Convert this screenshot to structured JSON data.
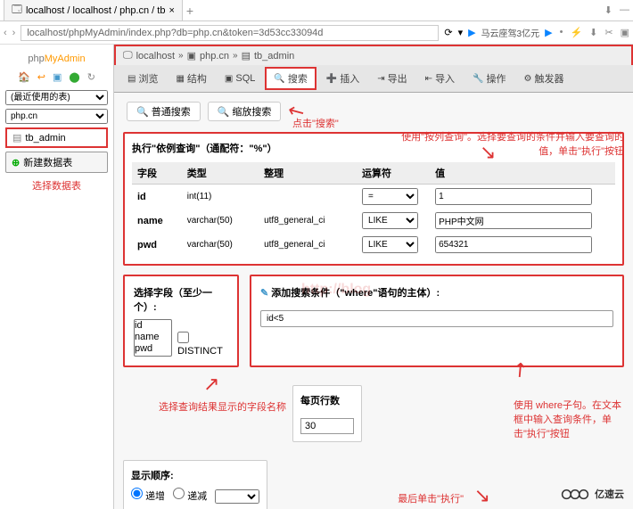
{
  "browser": {
    "tab_title": "localhost / localhost / php.cn / tb",
    "url": "localhost/phpMyAdmin/index.php?db=php.cn&token=3d53cc33094d",
    "fav_text": "马云座驾3亿元"
  },
  "sidebar": {
    "logo_parts": [
      "php",
      "My",
      "Admin"
    ],
    "recent_tables_label": "(最近使用的表)",
    "database": "php.cn",
    "table": "tb_admin",
    "new_table_label": "新建数据表",
    "annotation": "选择数据表"
  },
  "breadcrumb": {
    "host": "localhost",
    "db": "php.cn",
    "table": "tb_admin"
  },
  "tabs": {
    "browse": "浏览",
    "structure": "结构",
    "sql": "SQL",
    "search": "搜索",
    "insert": "插入",
    "export": "导出",
    "import": "导入",
    "operations": "操作",
    "triggers": "触发器"
  },
  "search_anno": "点击\"搜索\"",
  "subtabs": {
    "normal": "普通搜索",
    "zoom": "缩放搜索"
  },
  "query_panel": {
    "title": "执行\"依例查询\"（通配符：\"%\"）",
    "anno": "使用\"按列查询\"。选择要查询的条件并输入要查询的值，单击\"执行\"按钮",
    "headers": {
      "field": "字段",
      "type": "类型",
      "collation": "整理",
      "operator": "运算符",
      "value": "值"
    },
    "rows": [
      {
        "field": "id",
        "type": "int(11)",
        "collation": "",
        "operator": "=",
        "value": "1"
      },
      {
        "field": "name",
        "type": "varchar(50)",
        "collation": "utf8_general_ci",
        "operator": "LIKE",
        "value": "PHP中文网"
      },
      {
        "field": "pwd",
        "type": "varchar(50)",
        "collation": "utf8_general_ci",
        "operator": "LIKE",
        "value": "654321"
      }
    ]
  },
  "select_fields": {
    "title": "选择字段（至少一个）:",
    "options": [
      "id",
      "name",
      "pwd"
    ],
    "distinct_label": "DISTINCT",
    "anno": "选择查询结果显示的字段名称"
  },
  "where": {
    "title": "添加搜索条件（\"where\"语句的主体）:",
    "value": "id<5",
    "anno": "使用 where子句。在文本框中输入查询条件，单击\"执行\"按钮"
  },
  "rows_per_page": {
    "title": "每页行数",
    "value": "30"
  },
  "order": {
    "title": "显示顺序:",
    "asc_label": "递增",
    "desc_label": "递减"
  },
  "go_btn": "最后单击\"执行\"",
  "footer_brand": "亿速云"
}
